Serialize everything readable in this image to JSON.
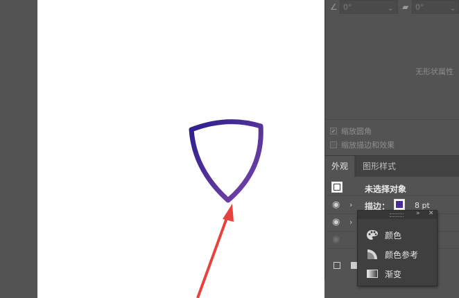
{
  "toolbar": {
    "angle1_value": "0°",
    "angle2_value": "0°"
  },
  "transform": {
    "no_shape_text": "无形状属性",
    "scale_corners": {
      "label": "缩放圆角",
      "checked": true
    },
    "scale_strokes": {
      "label": "缩放描边和效果",
      "checked": false
    }
  },
  "tabs": [
    {
      "label": "外观",
      "active": true
    },
    {
      "label": "图形样式",
      "active": false
    }
  ],
  "appearance": {
    "title": "未选择对象",
    "stroke_label": "描边：",
    "stroke_weight": "8 pt",
    "stroke_color": "#4a2b9a"
  },
  "popup": {
    "items": [
      {
        "label": "颜色",
        "icon": "color-palette-icon"
      },
      {
        "label": "颜色参考",
        "icon": "color-guide-icon"
      },
      {
        "label": "渐变",
        "icon": "gradient-icon"
      }
    ]
  },
  "artwork": {
    "gradient_start": "#2c1f8c",
    "gradient_end": "#7a45a8",
    "arrow_color": "#e8423f"
  }
}
